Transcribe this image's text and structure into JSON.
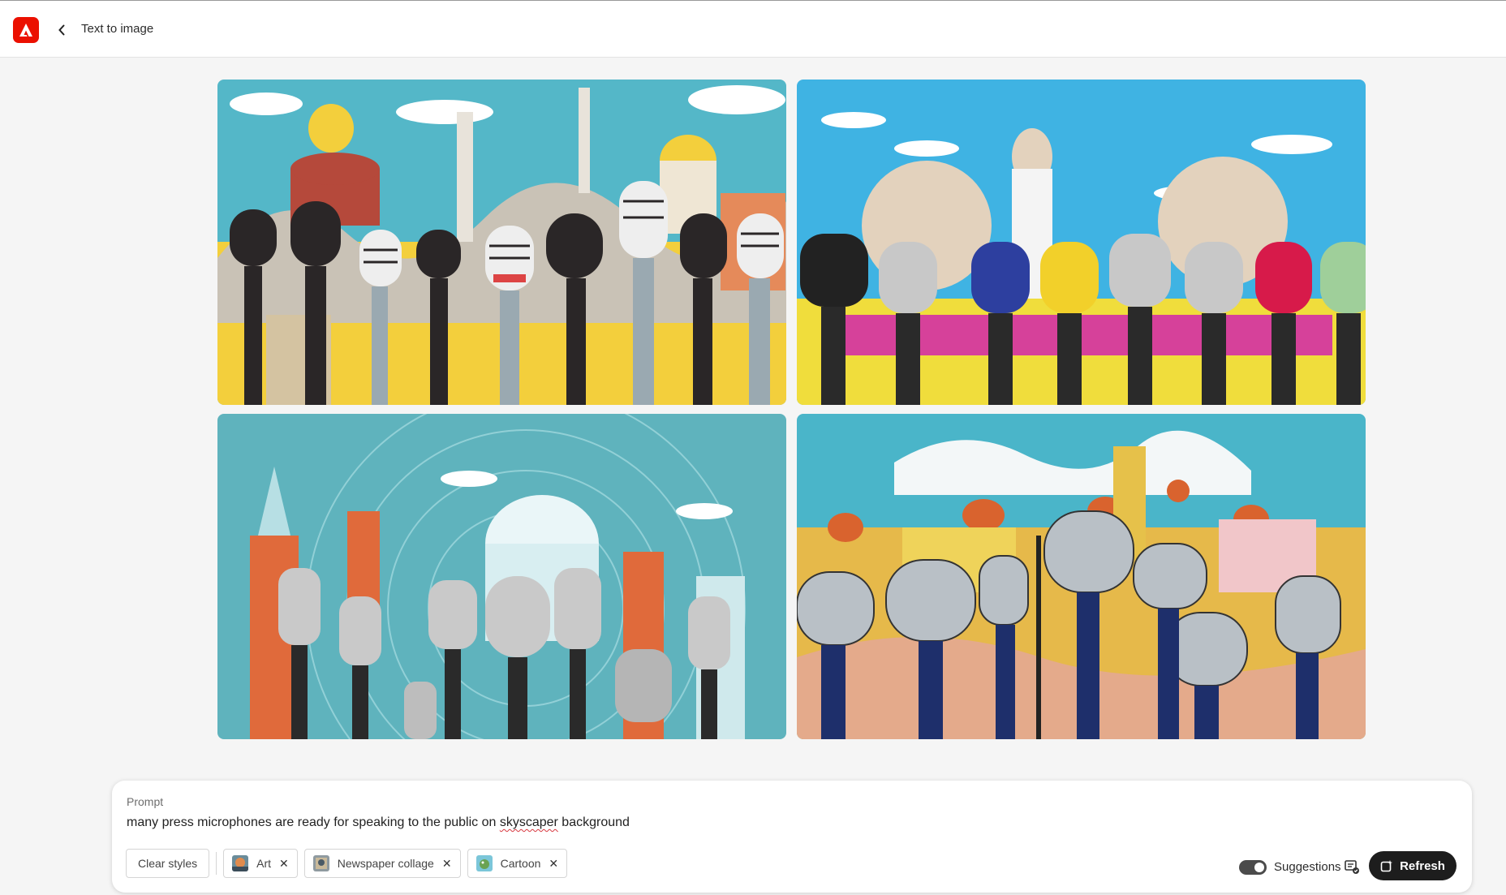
{
  "header": {
    "title": "Text to image",
    "logo_icon": "adobe-logo-icon",
    "back_icon": "chevron-left-icon",
    "brand_color": "#eb1000"
  },
  "gallery": {
    "images": [
      {
        "alt": "Generated image 1"
      },
      {
        "alt": "Generated image 2"
      },
      {
        "alt": "Generated image 3"
      },
      {
        "alt": "Generated image 4"
      }
    ]
  },
  "prompt": {
    "label": "Prompt",
    "text_before": "many press microphones are ready for speaking to the public on ",
    "text_misspelled": "skyscaper",
    "text_after": " background",
    "clear_styles_label": "Clear styles",
    "styles": [
      {
        "label": "Art",
        "remove_icon": "close-icon"
      },
      {
        "label": "Newspaper collage",
        "remove_icon": "close-icon"
      },
      {
        "label": "Cartoon",
        "remove_icon": "close-icon"
      }
    ],
    "suggestions_label": "Suggestions",
    "suggestions_on": true,
    "refresh_label": "Refresh"
  }
}
